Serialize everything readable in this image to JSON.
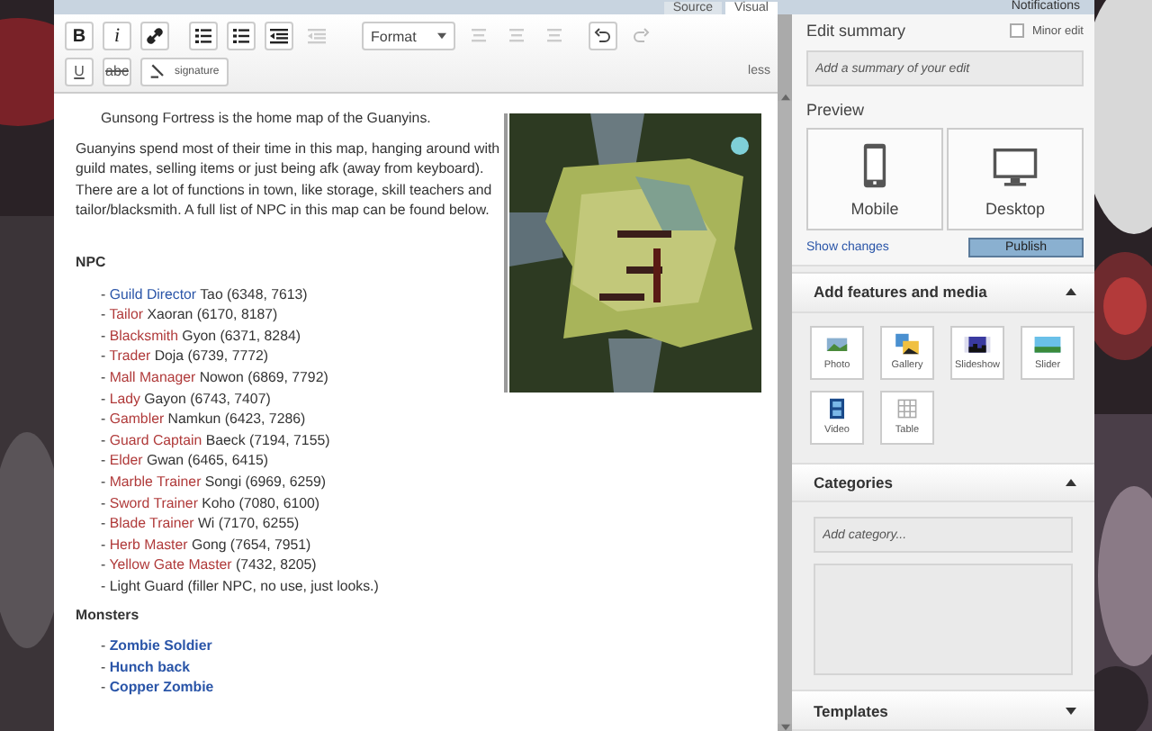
{
  "top_tabs": [
    {
      "label": "Source",
      "selected": false
    },
    {
      "label": "Visual",
      "selected": true
    }
  ],
  "notifications": "Notifications",
  "toolbar": {
    "row1": [
      {
        "kind": "bold",
        "label": "B",
        "disabled": false
      },
      {
        "kind": "italic",
        "label": "i",
        "disabled": false
      },
      {
        "kind": "link",
        "disabled": false
      },
      {
        "kind": "bullets",
        "disabled": false
      },
      {
        "kind": "numbers",
        "disabled": false
      },
      {
        "kind": "outdent",
        "disabled": false
      },
      {
        "kind": "indent",
        "disabled": true
      },
      {
        "kind": "format",
        "label": "Format",
        "disabled": false
      },
      {
        "kind": "align",
        "disabled": true
      },
      {
        "kind": "align",
        "disabled": true
      },
      {
        "kind": "align",
        "disabled": true
      },
      {
        "kind": "undo",
        "disabled": false
      },
      {
        "kind": "redo",
        "disabled": true
      }
    ],
    "row2": [
      {
        "kind": "underline",
        "label": "U"
      },
      {
        "kind": "strike",
        "label": "abc"
      },
      {
        "kind": "signature",
        "label": "signature"
      }
    ],
    "less": "less"
  },
  "article": {
    "intro": "Gunsong Fortress is the home map of the Guanyins.",
    "paragraph_lines": [
      "Guanyins spend most of their time in this map, hanging around with guild mates, selling items or just being afk (away from keyboard).",
      "There are a lot of functions in town, like storage, skill teachers and tailor/blacksmith. A full list of NPC in this map can be found below."
    ],
    "map": {
      "kind": "picture"
    },
    "list_marker": "-",
    "sections": [
      {
        "heading": "NPC",
        "items": [
          {
            "link": "Guild Director",
            "kind": "link",
            "rest": "Tao (6348, 7613)"
          },
          {
            "link": "Tailor",
            "kind": "redlink",
            "rest": "Xaoran (6170, 8187)"
          },
          {
            "link": "Blacksmith",
            "kind": "redlink",
            "rest": "Gyon (6371, 8284)"
          },
          {
            "link": "Trader",
            "kind": "redlink",
            "rest": "Doja (6739, 7772)"
          },
          {
            "link": "Mall Manager",
            "kind": "redlink",
            "rest": "Nowon (6869, 7792)"
          },
          {
            "link": "Lady",
            "kind": "redlink",
            "rest": "Gayon (6743, 7407)"
          },
          {
            "link": "Gambler",
            "kind": "redlink",
            "rest": "Namkun (6423, 7286)"
          },
          {
            "link": "Guard Captain",
            "kind": "redlink",
            "rest": "Baeck (7194, 7155)"
          },
          {
            "link": "Elder",
            "kind": "redlink",
            "rest": "Gwan (6465, 6415)"
          },
          {
            "link": "Marble Trainer",
            "kind": "redlink",
            "rest": "Songi (6969, 6259)"
          },
          {
            "link": "Sword Trainer",
            "kind": "redlink",
            "rest": "Koho (7080, 6100)"
          },
          {
            "link": "Blade Trainer",
            "kind": "redlink",
            "rest": "Wi (7170, 6255)"
          },
          {
            "link": "Herb Master",
            "kind": "redlink",
            "rest": "Gong (7654, 7951)"
          },
          {
            "link": "Yellow Gate Master",
            "kind": "redlink",
            "rest": "(7432, 8205)"
          },
          {
            "kind": "plain",
            "rest": "Light Guard (filler NPC, no use, just looks.)"
          }
        ]
      },
      {
        "heading": "Monsters",
        "items": [
          {
            "link": "Zombie Soldier",
            "kind": "boldlink"
          },
          {
            "link": "Hunch back",
            "kind": "boldlink"
          },
          {
            "link": "Copper Zombie",
            "kind": "boldlink"
          }
        ]
      }
    ]
  },
  "panel": {
    "edit_summary": {
      "title": "Edit summary",
      "minor_edit": {
        "label": "Minor edit",
        "checked": false
      },
      "placeholder": "Add a summary of your edit"
    },
    "preview": {
      "title": "Preview",
      "options": [
        {
          "kind": "mobile",
          "label": "Mobile"
        },
        {
          "kind": "desktop",
          "label": "Desktop"
        }
      ],
      "show_changes": "Show changes",
      "publish": "Publish"
    },
    "modules": [
      {
        "title": "Add features and media",
        "expanded": true,
        "kind": "media",
        "items": [
          {
            "label": "Photo"
          },
          {
            "kind": "gallery",
            "label": "Gallery"
          },
          {
            "kind": "slideshow",
            "label": "Slideshow"
          },
          {
            "kind": "slider",
            "label": "Slider"
          },
          {
            "kind": "video",
            "label": "Video"
          },
          {
            "kind": "table",
            "label": "Table"
          }
        ]
      },
      {
        "title": "Categories",
        "expanded": true,
        "kind": "categories",
        "placeholder": "Add category..."
      },
      {
        "title": "Templates",
        "expanded": false,
        "kind": "templates"
      }
    ]
  }
}
